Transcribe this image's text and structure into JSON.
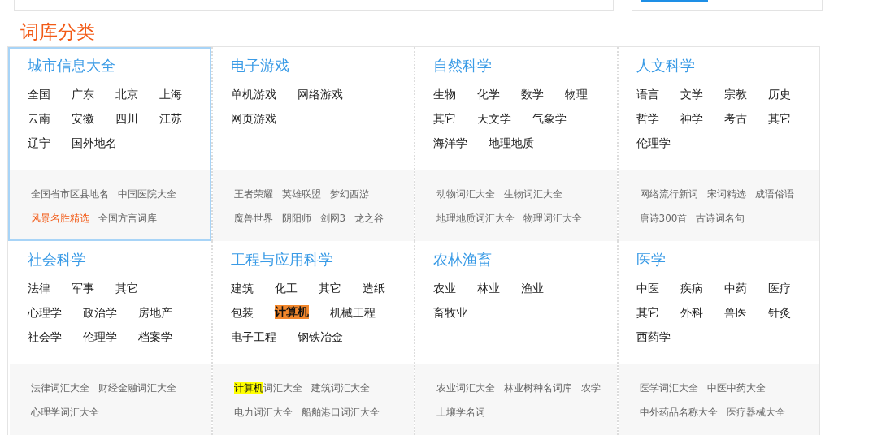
{
  "heading": "词库分类",
  "categories": [
    {
      "title": "城市信息大全",
      "selected": true,
      "items": [
        {
          "text": "全国",
          "highlighted": false
        },
        {
          "text": "广东",
          "highlighted": false
        },
        {
          "text": "北京",
          "highlighted": false
        },
        {
          "text": "上海",
          "highlighted": false
        },
        {
          "text": "云南",
          "highlighted": false
        },
        {
          "text": "安徽",
          "highlighted": false
        },
        {
          "text": "四川",
          "highlighted": false
        },
        {
          "text": "江苏",
          "highlighted": false
        },
        {
          "text": "辽宁",
          "highlighted": false
        },
        {
          "text": "国外地名",
          "highlighted": false
        }
      ],
      "links": [
        {
          "accent": false,
          "parts": [
            {
              "text": "全国省市区县地名",
              "highlighted": false
            }
          ]
        },
        {
          "accent": false,
          "parts": [
            {
              "text": "中国医院大全",
              "highlighted": false
            }
          ]
        },
        {
          "accent": true,
          "parts": [
            {
              "text": "风景名胜精选",
              "highlighted": false
            }
          ]
        },
        {
          "accent": false,
          "parts": [
            {
              "text": "全国方言词库",
              "highlighted": false
            }
          ]
        }
      ]
    },
    {
      "title": "电子游戏",
      "selected": false,
      "items": [
        {
          "text": "单机游戏",
          "highlighted": false
        },
        {
          "text": "网络游戏",
          "highlighted": false
        },
        {
          "text": "网页游戏",
          "highlighted": false
        }
      ],
      "links": [
        {
          "accent": false,
          "parts": [
            {
              "text": "王者荣耀",
              "highlighted": false
            }
          ]
        },
        {
          "accent": false,
          "parts": [
            {
              "text": "英雄联盟",
              "highlighted": false
            }
          ]
        },
        {
          "accent": false,
          "parts": [
            {
              "text": "梦幻西游",
              "highlighted": false
            }
          ]
        },
        {
          "accent": false,
          "parts": [
            {
              "text": "魔兽世界",
              "highlighted": false
            }
          ]
        },
        {
          "accent": false,
          "parts": [
            {
              "text": "阴阳师",
              "highlighted": false
            }
          ]
        },
        {
          "accent": false,
          "parts": [
            {
              "text": "剑网3",
              "highlighted": false
            }
          ]
        },
        {
          "accent": false,
          "parts": [
            {
              "text": "龙之谷",
              "highlighted": false
            }
          ]
        }
      ]
    },
    {
      "title": "自然科学",
      "selected": false,
      "items": [
        {
          "text": "生物",
          "highlighted": false
        },
        {
          "text": "化学",
          "highlighted": false
        },
        {
          "text": "数学",
          "highlighted": false
        },
        {
          "text": "物理",
          "highlighted": false
        },
        {
          "text": "其它",
          "highlighted": false
        },
        {
          "text": "天文学",
          "highlighted": false
        },
        {
          "text": "气象学",
          "highlighted": false
        },
        {
          "text": "海洋学",
          "highlighted": false
        },
        {
          "text": "地理地质",
          "highlighted": false
        }
      ],
      "links": [
        {
          "accent": false,
          "parts": [
            {
              "text": "动物词汇大全",
              "highlighted": false
            }
          ]
        },
        {
          "accent": false,
          "parts": [
            {
              "text": "生物词汇大全",
              "highlighted": false
            }
          ]
        },
        {
          "accent": false,
          "parts": [
            {
              "text": "地理地质词汇大全",
              "highlighted": false
            }
          ]
        },
        {
          "accent": false,
          "parts": [
            {
              "text": "物理词汇大全",
              "highlighted": false
            }
          ]
        }
      ]
    },
    {
      "title": "人文科学",
      "selected": false,
      "items": [
        {
          "text": "语言",
          "highlighted": false
        },
        {
          "text": "文学",
          "highlighted": false
        },
        {
          "text": "宗教",
          "highlighted": false
        },
        {
          "text": "历史",
          "highlighted": false
        },
        {
          "text": "哲学",
          "highlighted": false
        },
        {
          "text": "神学",
          "highlighted": false
        },
        {
          "text": "考古",
          "highlighted": false
        },
        {
          "text": "其它",
          "highlighted": false
        },
        {
          "text": "伦理学",
          "highlighted": false
        }
      ],
      "links": [
        {
          "accent": false,
          "parts": [
            {
              "text": "网络流行新词",
              "highlighted": false
            }
          ]
        },
        {
          "accent": false,
          "parts": [
            {
              "text": "宋词精选",
              "highlighted": false
            }
          ]
        },
        {
          "accent": false,
          "parts": [
            {
              "text": "成语俗语",
              "highlighted": false
            }
          ]
        },
        {
          "accent": false,
          "parts": [
            {
              "text": "唐诗300首",
              "highlighted": false
            }
          ]
        },
        {
          "accent": false,
          "parts": [
            {
              "text": "古诗词名句",
              "highlighted": false
            }
          ]
        }
      ]
    },
    {
      "title": "社会科学",
      "selected": false,
      "items": [
        {
          "text": "法律",
          "highlighted": false
        },
        {
          "text": "军事",
          "highlighted": false
        },
        {
          "text": "其它",
          "highlighted": false
        },
        {
          "text": "心理学",
          "highlighted": false
        },
        {
          "text": "政治学",
          "highlighted": false
        },
        {
          "text": "房地产",
          "highlighted": false
        },
        {
          "text": "社会学",
          "highlighted": false
        },
        {
          "text": "伦理学",
          "highlighted": false
        },
        {
          "text": "档案学",
          "highlighted": false
        }
      ],
      "links": [
        {
          "accent": false,
          "parts": [
            {
              "text": "法律词汇大全",
              "highlighted": false
            }
          ]
        },
        {
          "accent": false,
          "parts": [
            {
              "text": "财经金融词汇大全",
              "highlighted": false
            }
          ]
        },
        {
          "accent": false,
          "parts": [
            {
              "text": "心理学词汇大全",
              "highlighted": false
            }
          ]
        }
      ]
    },
    {
      "title": "工程与应用科学",
      "selected": false,
      "items": [
        {
          "text": "建筑",
          "highlighted": false
        },
        {
          "text": "化工",
          "highlighted": false
        },
        {
          "text": "其它",
          "highlighted": false
        },
        {
          "text": "造纸",
          "highlighted": false
        },
        {
          "text": "包装",
          "highlighted": false
        },
        {
          "text": "计算机",
          "highlighted": true
        },
        {
          "text": "机械工程",
          "highlighted": false
        },
        {
          "text": "电子工程",
          "highlighted": false
        },
        {
          "text": "钢铁冶金",
          "highlighted": false
        }
      ],
      "links": [
        {
          "accent": false,
          "parts": [
            {
              "text": "计算机",
              "highlighted": true
            },
            {
              "text": "词汇大全",
              "highlighted": false
            }
          ]
        },
        {
          "accent": false,
          "parts": [
            {
              "text": "建筑词汇大全",
              "highlighted": false
            }
          ]
        },
        {
          "accent": false,
          "parts": [
            {
              "text": "电力词汇大全",
              "highlighted": false
            }
          ]
        },
        {
          "accent": false,
          "parts": [
            {
              "text": "船舶港口词汇大全",
              "highlighted": false
            }
          ]
        }
      ]
    },
    {
      "title": "农林渔畜",
      "selected": false,
      "items": [
        {
          "text": "农业",
          "highlighted": false
        },
        {
          "text": "林业",
          "highlighted": false
        },
        {
          "text": "渔业",
          "highlighted": false
        },
        {
          "text": "畜牧业",
          "highlighted": false
        }
      ],
      "links": [
        {
          "accent": false,
          "parts": [
            {
              "text": "农业词汇大全",
              "highlighted": false
            }
          ]
        },
        {
          "accent": false,
          "parts": [
            {
              "text": "林业树种名词库",
              "highlighted": false
            }
          ]
        },
        {
          "accent": false,
          "parts": [
            {
              "text": "农学",
              "highlighted": false
            }
          ]
        },
        {
          "accent": false,
          "parts": [
            {
              "text": "土壤学名词",
              "highlighted": false
            }
          ]
        }
      ]
    },
    {
      "title": "医学",
      "selected": false,
      "items": [
        {
          "text": "中医",
          "highlighted": false
        },
        {
          "text": "疾病",
          "highlighted": false
        },
        {
          "text": "中药",
          "highlighted": false
        },
        {
          "text": "医疗",
          "highlighted": false
        },
        {
          "text": "其它",
          "highlighted": false
        },
        {
          "text": "外科",
          "highlighted": false
        },
        {
          "text": "兽医",
          "highlighted": false
        },
        {
          "text": "针灸",
          "highlighted": false
        },
        {
          "text": "西药学",
          "highlighted": false
        }
      ],
      "links": [
        {
          "accent": false,
          "parts": [
            {
              "text": "医学词汇大全",
              "highlighted": false
            }
          ]
        },
        {
          "accent": false,
          "parts": [
            {
              "text": "中医中药大全",
              "highlighted": false
            }
          ]
        },
        {
          "accent": false,
          "parts": [
            {
              "text": "中外药品名称大全",
              "highlighted": false
            }
          ]
        },
        {
          "accent": false,
          "parts": [
            {
              "text": "医疗器械大全",
              "highlighted": false
            }
          ]
        }
      ]
    }
  ]
}
